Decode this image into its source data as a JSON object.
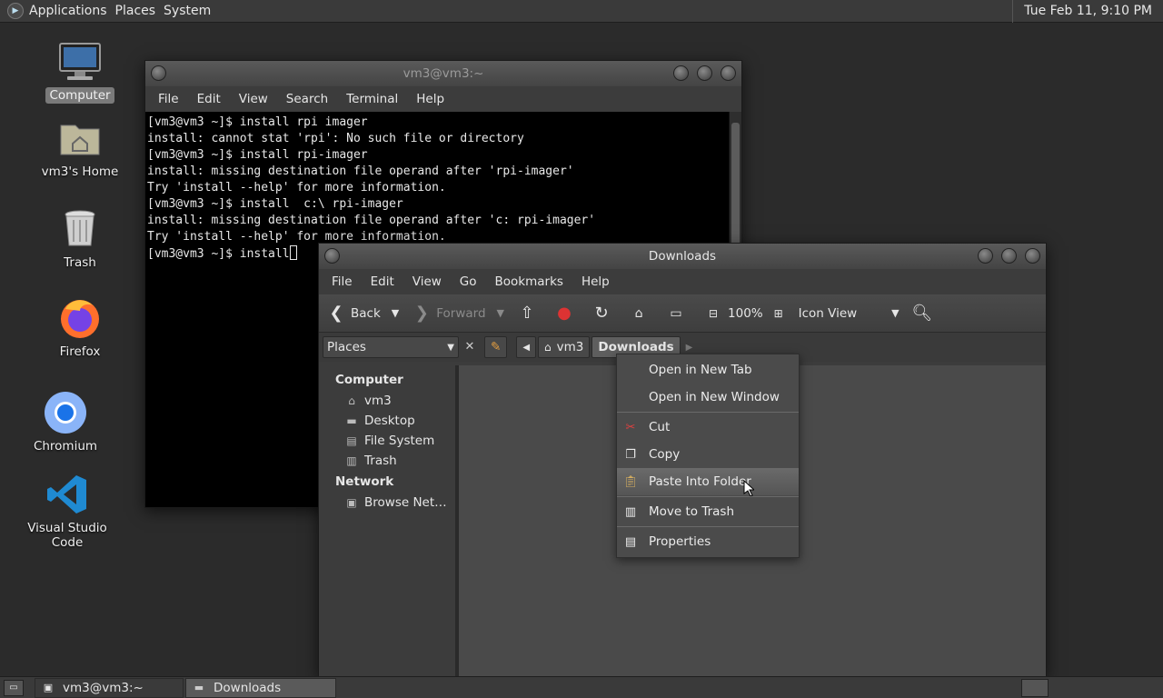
{
  "top_panel": {
    "menus": [
      "Applications",
      "Places",
      "System"
    ],
    "clock": "Tue Feb 11,  9:10 PM"
  },
  "desktop_icons": [
    {
      "label": "Computer",
      "icon": "computer-icon"
    },
    {
      "label": "vm3's Home",
      "icon": "home-folder-icon"
    },
    {
      "label": "Trash",
      "icon": "trash-icon"
    },
    {
      "label": "Firefox",
      "icon": "firefox-icon"
    },
    {
      "label": "Chromium",
      "icon": "chromium-icon"
    },
    {
      "label": "Visual Studio Code",
      "icon": "vscode-icon"
    }
  ],
  "terminal": {
    "title": "vm3@vm3:~",
    "menus": [
      "File",
      "Edit",
      "View",
      "Search",
      "Terminal",
      "Help"
    ],
    "lines": [
      "[vm3@vm3 ~]$ install rpi imager",
      "install: cannot stat 'rpi': No such file or directory",
      "[vm3@vm3 ~]$ install rpi-imager",
      "install: missing destination file operand after 'rpi-imager'",
      "Try 'install --help' for more information.",
      "[vm3@vm3 ~]$ install  c:\\ rpi-imager",
      "install: missing destination file operand after 'c: rpi-imager'",
      "Try 'install --help' for more information."
    ],
    "prompt": "[vm3@vm3 ~]$ install"
  },
  "file_manager": {
    "title": "Downloads",
    "menus": [
      "File",
      "Edit",
      "View",
      "Go",
      "Bookmarks",
      "Help"
    ],
    "toolbar": {
      "back": "Back",
      "forward": "Forward",
      "zoom": "100%",
      "view_mode": "Icon View"
    },
    "places_label": "Places",
    "breadcrumbs": [
      "vm3",
      "Downloads"
    ],
    "sidebar": {
      "computer_header": "Computer",
      "computer_items": [
        {
          "label": "vm3",
          "icon": "home-icon"
        },
        {
          "label": "Desktop",
          "icon": "desktop-icon"
        },
        {
          "label": "File System",
          "icon": "drive-icon"
        },
        {
          "label": "Trash",
          "icon": "trash-icon"
        }
      ],
      "network_header": "Network",
      "network_items": [
        {
          "label": "Browse Net…",
          "icon": "network-icon"
        }
      ]
    }
  },
  "context_menu": {
    "items": [
      {
        "label": "Open in New Tab",
        "icon": ""
      },
      {
        "label": "Open in New Window",
        "icon": ""
      },
      {
        "label": "Cut",
        "icon": "scissors-icon"
      },
      {
        "label": "Copy",
        "icon": "copy-icon"
      },
      {
        "label": "Paste Into Folder",
        "icon": "paste-icon"
      },
      {
        "label": "Move to Trash",
        "icon": "trash-icon"
      },
      {
        "label": "Properties",
        "icon": "properties-icon"
      }
    ]
  },
  "taskbar": {
    "tasks": [
      "vm3@vm3:~",
      "Downloads"
    ]
  }
}
